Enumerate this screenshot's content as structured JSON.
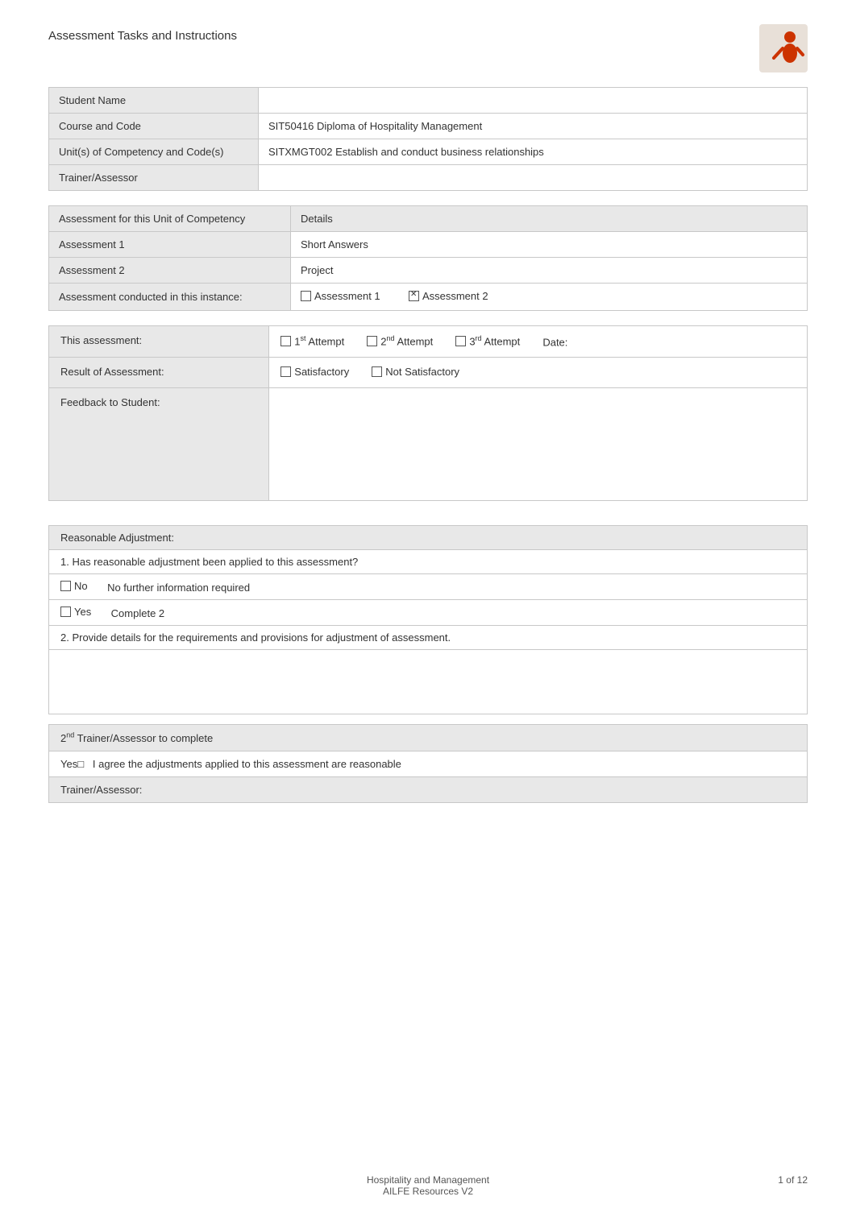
{
  "header": {
    "title": "Assessment Tasks and Instructions",
    "logo_alt": "logo-icon"
  },
  "student_info": {
    "fields": [
      {
        "label": "Student Name",
        "value": ""
      },
      {
        "label": "Course and Code",
        "value": "SIT50416 Diploma of Hospitality Management"
      },
      {
        "label": "Unit(s) of Competency and Code(s)",
        "value": "SITXMGT002 Establish and conduct business relationships"
      },
      {
        "label": "Trainer/Assessor",
        "value": ""
      }
    ]
  },
  "assessment_list": {
    "header_label": "Assessment for this Unit of Competency",
    "header_detail": "Details",
    "items": [
      {
        "label": "Assessment 1",
        "detail": "Short Answers"
      },
      {
        "label": "Assessment 2",
        "detail": "Project"
      }
    ],
    "conducted_label": "Assessment conducted in this instance:",
    "assessment1_label": "Assessment 1",
    "assessment2_label": "Assessment 2",
    "assessment1_checked": false,
    "assessment2_checked": true
  },
  "attempt_section": {
    "this_assessment_label": "This assessment:",
    "attempt1_label": "1st Attempt",
    "attempt2_label": "2nd Attempt",
    "attempt3_label": "3rd Attempt",
    "date_label": "Date:",
    "result_label": "Result of Assessment:",
    "satisfactory_label": "Satisfactory",
    "not_satisfactory_label": "Not Satisfactory",
    "satisfactory_checked": false,
    "not_satisfactory_checked": false,
    "attempt1_checked": false,
    "attempt2_checked": false,
    "attempt3_checked": false,
    "feedback_label": "Feedback to Student:"
  },
  "reasonable_adjustment": {
    "section_title": "Reasonable Adjustment:",
    "question1": "1.   Has reasonable adjustment been applied to this assessment?",
    "no_label": "No",
    "no_detail": "No further information required",
    "yes_label": "Yes",
    "yes_detail": "Complete 2",
    "question2": "2.   Provide details for the requirements and provisions for adjustment of assessment."
  },
  "trainer2": {
    "section_label": "2nd Trainer/Assessor to complete",
    "agree_text": "Yes□   I agree the adjustments applied to this assessment are reasonable",
    "trainer_label": "Trainer/Assessor:"
  },
  "footer": {
    "center": "Hospitality and Management\nAILFE Resources V2",
    "right": "1 of 12"
  }
}
